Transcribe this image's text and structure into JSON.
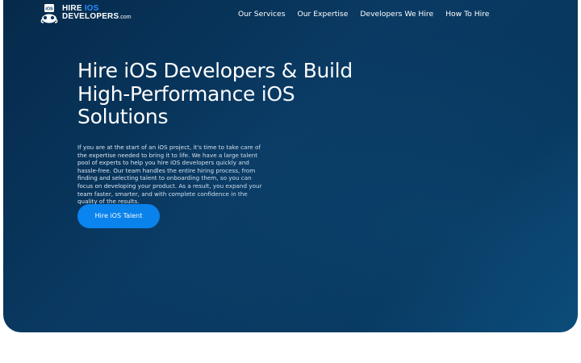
{
  "brand": {
    "line1_word": "HIRE",
    "line1_accent": "IOS",
    "line2_word": "DEVELOPERS",
    "line2_tld": ".com",
    "badge": "iOS",
    "accent_color": "#2b8cff"
  },
  "nav": {
    "items": [
      {
        "label": "Our Services"
      },
      {
        "label": "Our Expertise"
      },
      {
        "label": "Developers We Hire"
      },
      {
        "label": "How To Hire"
      }
    ]
  },
  "hero": {
    "title": "Hire iOS Developers & Build High-Performance iOS Solutions",
    "description": "If you are at the start of an iOS project, it's time to take care of the expertise needed to bring it to life. We have a large talent pool of experts to help you hire iOS developers quickly and hassle-free. Our team handles the entire hiring process, from finding and selecting talent to onboarding them, so you can focus on developing your product. As a result, you expand your team faster, smarter, and with complete confidence in the quality of the results.",
    "cta_label": "Hire iOS Talent",
    "background_color": "#06304f",
    "cta_color": "#0a84f0"
  }
}
